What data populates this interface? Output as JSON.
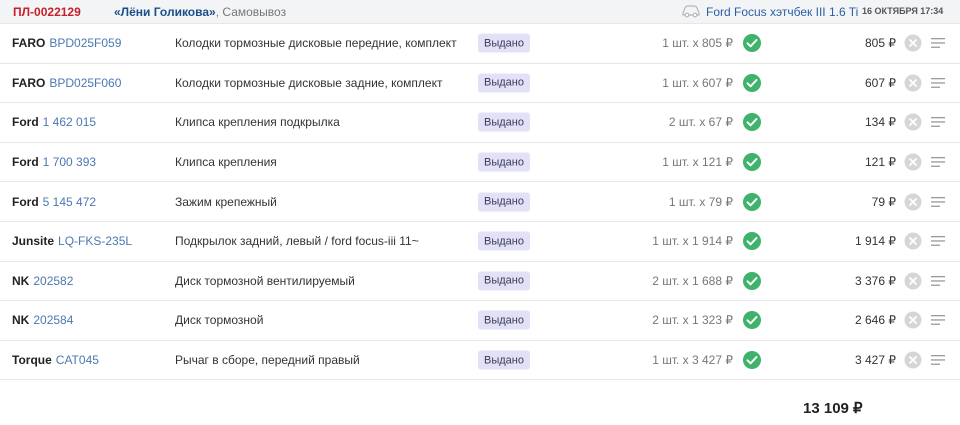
{
  "header": {
    "order_id": "ПЛ-0022129",
    "client_name": "«Лёни Голикова»",
    "delivery": ", Самовывоз",
    "car": "Ford Focus хэтчбек III 1.6 Ti",
    "date": "16 ОКТЯБРЯ 17:34"
  },
  "items": [
    {
      "brand": "FARO",
      "article": "BPD025F059",
      "description": "Колодки тормозные дисковые передние, комплект",
      "status": "Выдано",
      "qty": "1 шт. x 805 ₽",
      "total": "805 ₽"
    },
    {
      "brand": "FARO",
      "article": "BPD025F060",
      "description": "Колодки тормозные дисковые задние, комплект",
      "status": "Выдано",
      "qty": "1 шт. x 607 ₽",
      "total": "607 ₽"
    },
    {
      "brand": "Ford",
      "article": "1 462 015",
      "description": "Клипса крепления подкрылка",
      "status": "Выдано",
      "qty": "2 шт. x 67 ₽",
      "total": "134 ₽"
    },
    {
      "brand": "Ford",
      "article": "1 700 393",
      "description": "Клипса крепления",
      "status": "Выдано",
      "qty": "1 шт. x 121 ₽",
      "total": "121 ₽"
    },
    {
      "brand": "Ford",
      "article": "5 145 472",
      "description": "Зажим крепежный",
      "status": "Выдано",
      "qty": "1 шт. x 79 ₽",
      "total": "79 ₽"
    },
    {
      "brand": "Junsite",
      "article": "LQ-FKS-235L",
      "description": "Подкрылок задний, левый / ford focus-iii 11~",
      "status": "Выдано",
      "qty": "1 шт. x 1 914 ₽",
      "total": "1 914 ₽"
    },
    {
      "brand": "NK",
      "article": "202582",
      "description": "Диск тормозной вентилируемый",
      "status": "Выдано",
      "qty": "2 шт. x 1 688 ₽",
      "total": "3 376 ₽"
    },
    {
      "brand": "NK",
      "article": "202584",
      "description": "Диск тормозной",
      "status": "Выдано",
      "qty": "2 шт. x 1 323 ₽",
      "total": "2 646 ₽"
    },
    {
      "brand": "Torque",
      "article": "CAT045",
      "description": "Рычаг в сборе, передний правый",
      "status": "Выдано",
      "qty": "1 шт. x 3 427 ₽",
      "total": "3 427 ₽"
    }
  ],
  "grand_total": "13 109 ₽",
  "colors": {
    "order_id": "#c8202a",
    "client": "#1a4f8a",
    "article": "#4b78b2",
    "badge_bg": "#e3e1f7",
    "check": "#3fb26b",
    "remove": "#d6d6d6"
  },
  "icons": {
    "car": "car-icon",
    "issued": "check-circle-icon",
    "remove": "close-circle-icon",
    "menu": "menu-icon"
  }
}
